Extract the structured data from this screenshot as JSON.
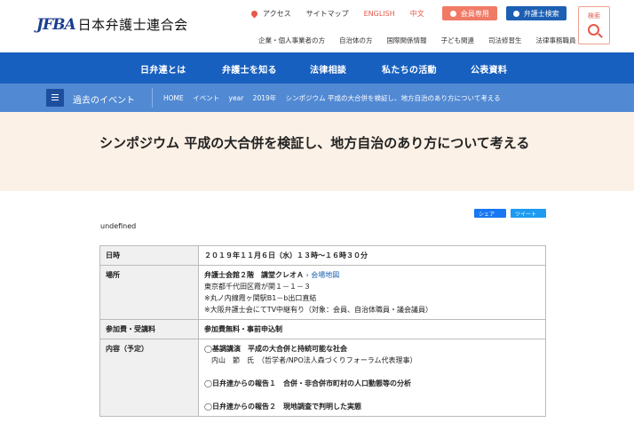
{
  "header": {
    "logo_mark": "JFBA",
    "logo_text": "日本弁護士連合会",
    "util": {
      "access": "アクセス",
      "sitemap": "サイトマップ",
      "english": "ENGLISH",
      "chinese": "中文",
      "member": "会員専用",
      "lawyer_search": "弁護士検索"
    },
    "search_label": "検索",
    "sub_nav": [
      "企業・個人事業者の方",
      "自治体の方",
      "国際関係情報",
      "子ども関連",
      "司法修習生",
      "法律事務職員"
    ]
  },
  "main_nav": [
    "日弁連とは",
    "弁護士を知る",
    "法律相談",
    "私たちの活動",
    "公表資料"
  ],
  "section": {
    "title": "過去のイベント",
    "breadcrumb": [
      "HOME",
      "イベント",
      "year",
      "2019年",
      "シンポジウム 平成の大合併を検証し、地方自治のあり方について考える"
    ]
  },
  "page": {
    "title": "シンポジウム 平成の大合併を検証し、地方自治のあり方について考える",
    "undefined_text": "undefined"
  },
  "share": {
    "facebook": "シェア",
    "twitter": "ツイート"
  },
  "table": {
    "date_label": "日時",
    "date_value": "２０１９年１１月６日（水）１３時～１６時３０分",
    "place_label": "場所",
    "place_line1": "弁護士会館２階　講堂クレオＡ",
    "place_map": "会場地図",
    "place_line2": "東京都千代田区霞が関１－１－３",
    "place_line3": "※丸ノ内線霞ヶ関駅B1－b出口直結",
    "place_line4": "※大阪弁護士会にてTV中継有り（対象：会員、自治体職員・議会議員）",
    "fee_label": "参加費・受講料",
    "fee_value": "参加費無料・事前申込制",
    "content_label": "内容（予定）",
    "content_item1": "◯基調講演　平成の大合併と持続可能な社会",
    "content_item1_speaker": "内山　節　氏　（哲学者/NPO法人森づくりフォーラム代表理事）",
    "content_item2": "◯日弁連からの報告１　合併・非合併市町村の人口動態等の分析",
    "content_item3": "◯日弁連からの報告２　現地調査で判明した実態"
  },
  "colors": {
    "brand_blue": "#1860bf",
    "sub_bar_blue": "#5189d3",
    "accent_red": "#e8584a",
    "title_band": "#fcf1e6"
  }
}
